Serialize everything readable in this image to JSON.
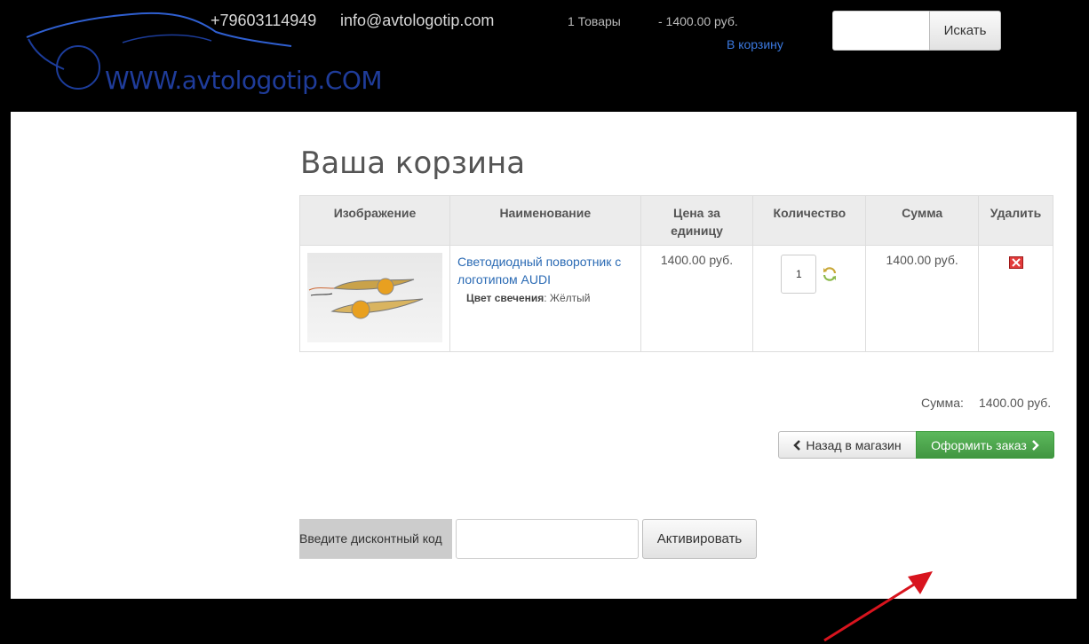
{
  "header": {
    "logo_text": "WWW.avtologotip.COM",
    "phone": "+79603114949",
    "email": "info@avtologotip.com",
    "cart_count": "1 Товары",
    "cart_total": "- 1400.00 руб.",
    "cart_link": "В корзину",
    "search_button": "Искать"
  },
  "page": {
    "title": "Ваша корзина"
  },
  "table": {
    "headers": [
      "Изображение",
      "Наименование",
      "Цена за единицу",
      "Количество",
      "Сумма",
      "Удалить"
    ],
    "rows": [
      {
        "name": "Светодиодный поворотник с логотипом AUDI",
        "option_label": "Цвет свечения",
        "option_value": ": Жёлтый",
        "price": "1400.00 руб.",
        "quantity": "1",
        "sum": "1400.00 руб."
      }
    ]
  },
  "totals": {
    "label": "Сумма:",
    "value": "1400.00 руб."
  },
  "buttons": {
    "back": "Назад в магазин",
    "checkout": "Оформить заказ"
  },
  "coupon": {
    "label": "Введите дисконтный код",
    "button": "Активировать"
  },
  "colors": {
    "accent_green": "#5cb85c",
    "link_blue": "#2a6ab4",
    "arrow_red": "#d8141e"
  }
}
